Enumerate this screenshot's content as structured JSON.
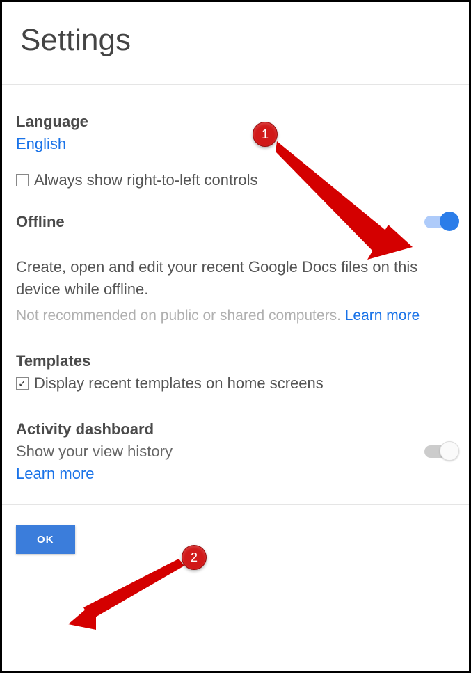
{
  "title": "Settings",
  "language": {
    "label": "Language",
    "value": "English",
    "rtl_checkbox_label": "Always show right-to-left controls",
    "rtl_checked": false
  },
  "offline": {
    "label": "Offline",
    "toggle_on": true,
    "description": "Create, open and edit your recent Google Docs files on this device while offline.",
    "note_prefix": "Not recommended on public or shared computers. ",
    "learn_more": "Learn more"
  },
  "templates": {
    "label": "Templates",
    "checkbox_label": "Display recent templates on home screens",
    "checked": true
  },
  "activity": {
    "label": "Activity dashboard",
    "description": "Show your view history",
    "toggle_on": false,
    "learn_more": "Learn more"
  },
  "footer": {
    "ok_label": "OK"
  },
  "annotations": {
    "badge1": "1",
    "badge2": "2"
  }
}
